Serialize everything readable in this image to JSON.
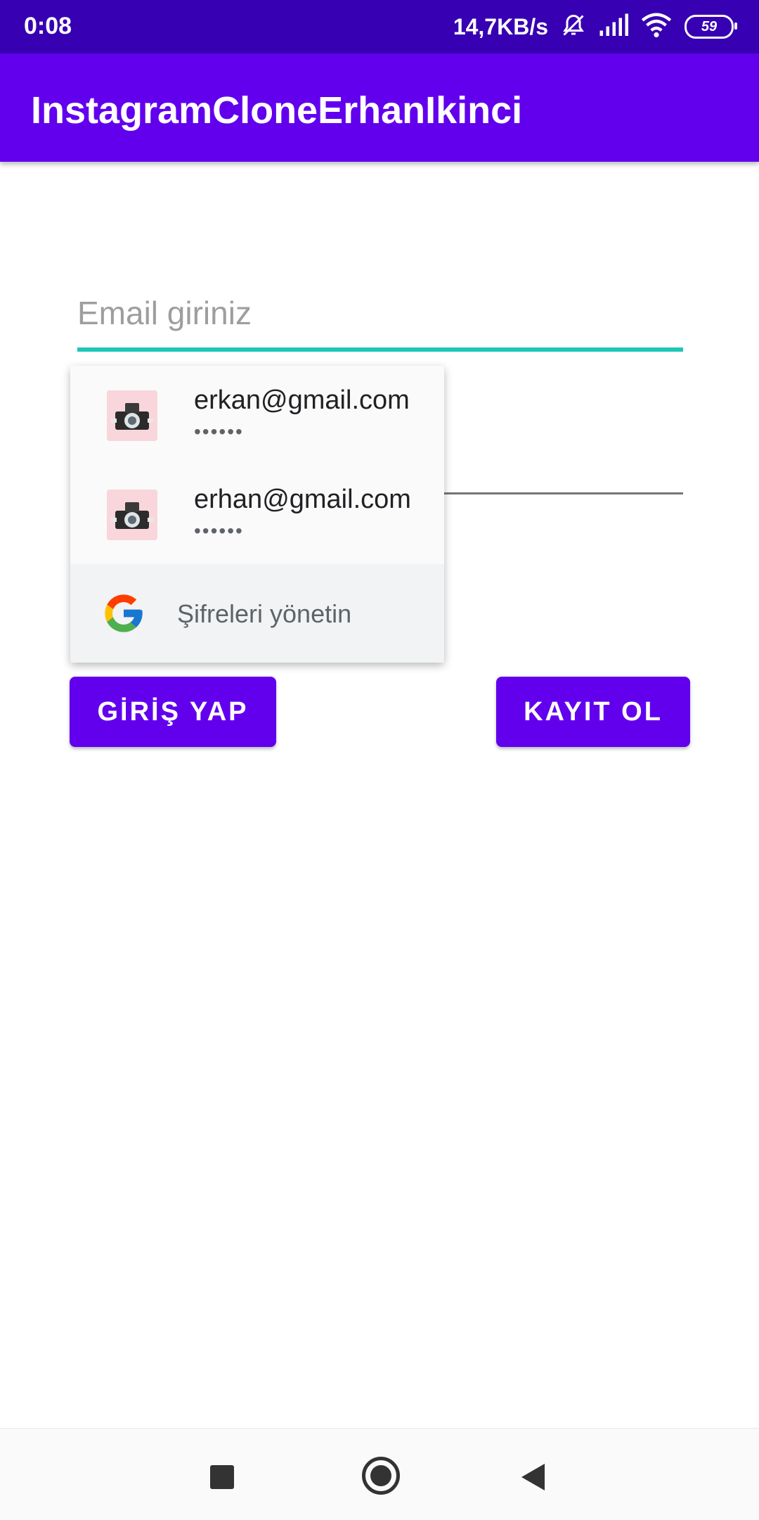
{
  "status_bar": {
    "time": "0:08",
    "network_speed": "14,7KB/s",
    "battery_level": "59",
    "icons": [
      "mute-icon",
      "signal-icon",
      "wifi-icon",
      "battery-icon"
    ]
  },
  "app_bar": {
    "title": "InstagramCloneErhanIkinci",
    "color": "#6200ee"
  },
  "form": {
    "email_placeholder": "Email giriniz",
    "email_value": "",
    "password_value": "",
    "accent_color": "#1ec6b8"
  },
  "autofill": {
    "accounts": [
      {
        "email": "erkan@gmail.com",
        "masked_password": "••••••",
        "icon": "camera-avatar-icon"
      },
      {
        "email": "erhan@gmail.com",
        "masked_password": "••••••",
        "icon": "camera-avatar-icon"
      }
    ],
    "manage_label": "Şifreleri yönetin",
    "manage_icon": "google-icon"
  },
  "buttons": {
    "login_label": "GİRİŞ YAP",
    "register_label": "KAYIT OL"
  },
  "nav_bar": {
    "icons": [
      "recents-icon",
      "home-icon",
      "back-icon"
    ]
  }
}
